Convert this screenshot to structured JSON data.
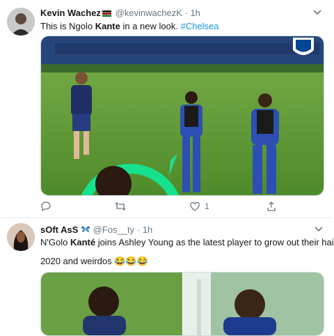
{
  "tweet1": {
    "name": "Kevin Wachez",
    "handle": "@kevinwachezK",
    "time": "1h",
    "text_pre": "This is Ngolo ",
    "text_bold": "Kante",
    "text_post": " in a new look. ",
    "hashtag": "#Chelsea",
    "likes": "1",
    "icons": [
      "chevron-down-icon",
      "reply-icon",
      "retweet-icon",
      "like-icon",
      "share-icon"
    ]
  },
  "tweet2": {
    "name": "sOft AsS",
    "handle": "@Fos__ty",
    "time": "1h",
    "text_pre": "N'Golo ",
    "text_bold": "Kanté",
    "text_post": " joins Ashley Young as the latest player to grow out their hair",
    "line2": "2020 and weirdos 😂😂😂",
    "icons": [
      "butterfly-icon",
      "chevron-down-icon"
    ]
  },
  "colors": {
    "link": "#1b95e0",
    "muted": "#657786",
    "pitch": "#5f9a36",
    "kit": "#2d4fb3",
    "circle": "#16e28e"
  }
}
